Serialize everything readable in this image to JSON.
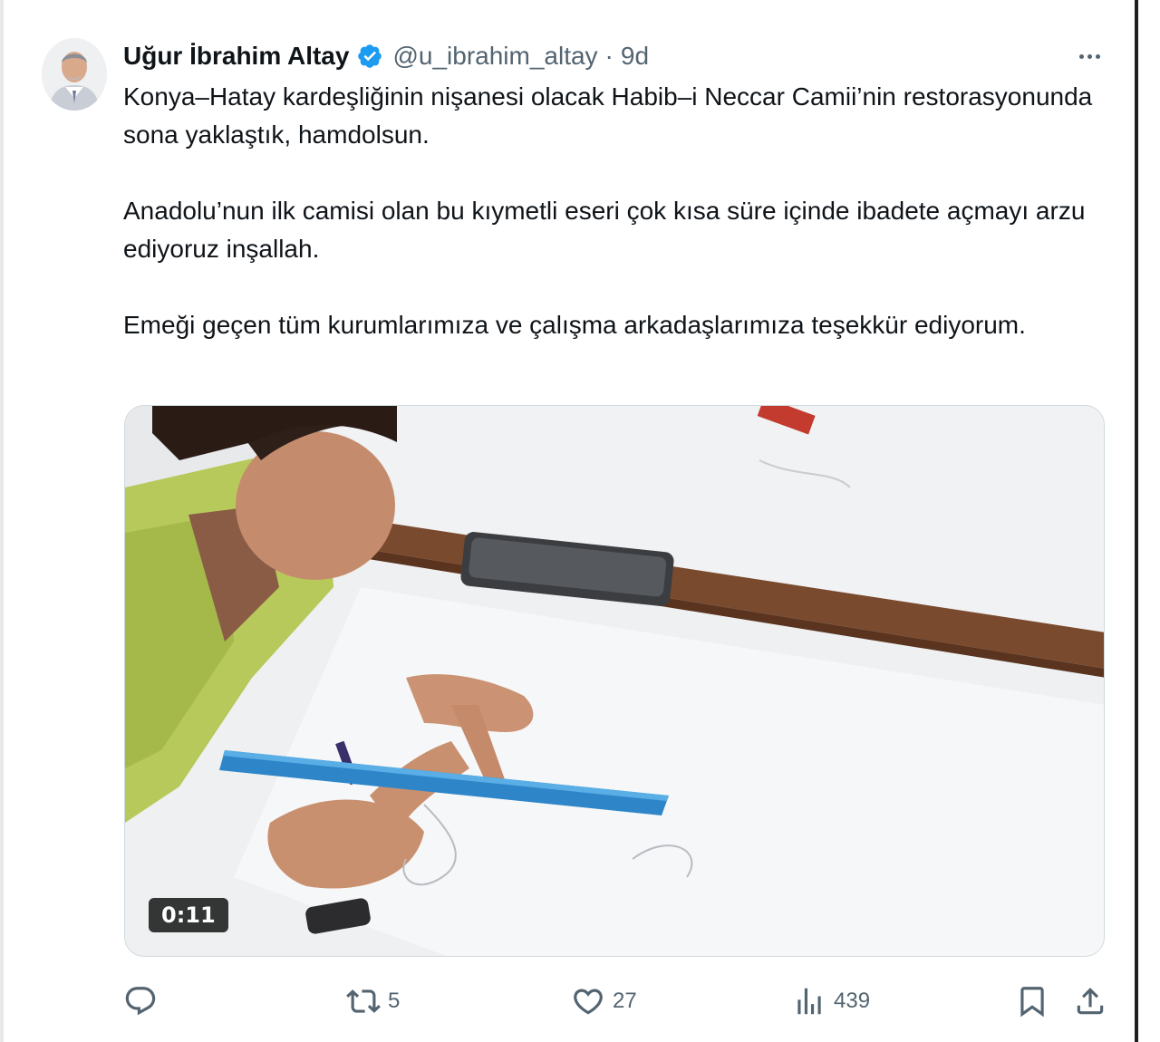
{
  "tweet": {
    "author_name": "Uğur İbrahim Altay",
    "handle": "@u_ibrahim_altay",
    "separator": "·",
    "time": "9d",
    "paragraphs": [
      "Konya–Hatay kardeşliğinin nişanesi olacak Habib–i Neccar Camii’nin restorasyonunda sona yaklaştık, hamdolsun.",
      "Anadolu’nun ilk camisi olan bu kıymetli eseri çok kısa süre içinde ibadete açmayı arzu ediyoruz inşallah.",
      "Emeği geçen tüm kurumlarımıza ve çalışma arkadaşlarımıza teşekkür ediyorum."
    ]
  },
  "video": {
    "duration": "0:11"
  },
  "actions": {
    "reply_count": "",
    "retweet_count": "5",
    "like_count": "27",
    "views_count": "439"
  },
  "colors": {
    "text_primary": "#0f1419",
    "text_secondary": "#536471",
    "verified_blue": "#1d9bf0"
  },
  "icons": [
    "verified-badge-icon",
    "more-icon",
    "reply-icon",
    "retweet-icon",
    "like-icon",
    "views-icon",
    "bookmark-icon",
    "share-icon"
  ]
}
